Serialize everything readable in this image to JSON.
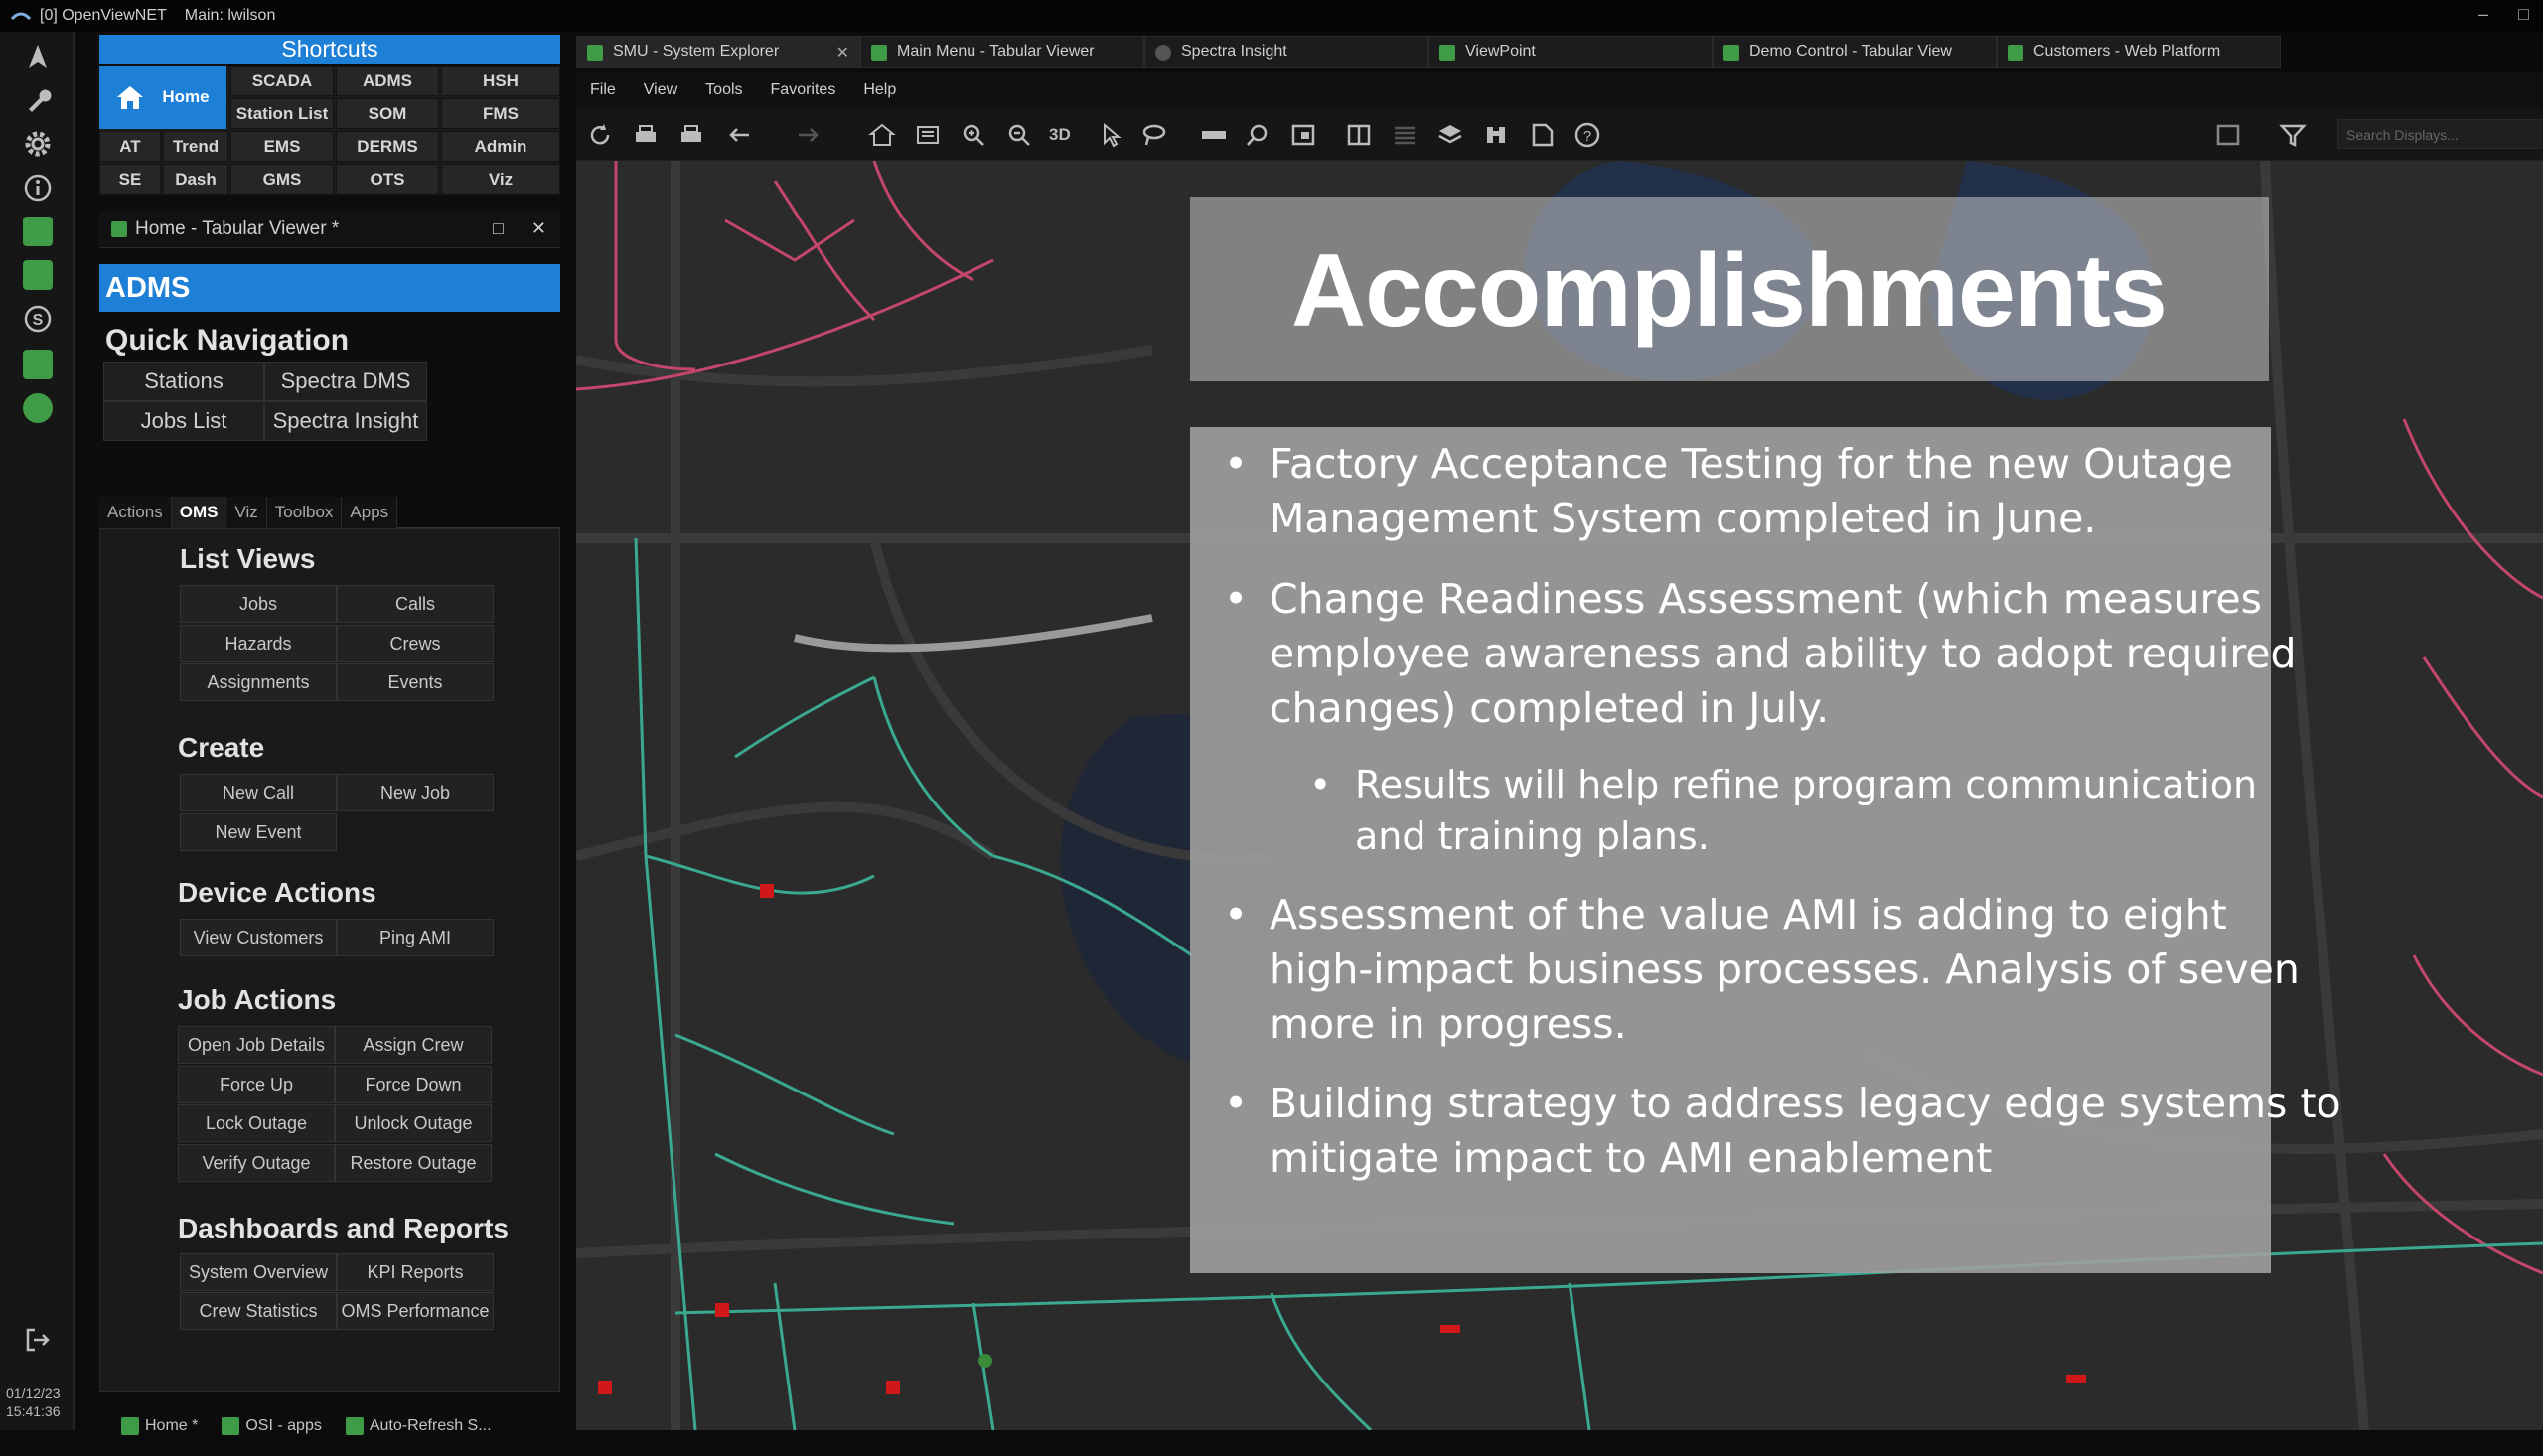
{
  "titlebar": {
    "app": "[0] OpenViewNET",
    "main": "Main: lwilson",
    "min": "–",
    "max": "□"
  },
  "rail": {
    "date": "01/12/23",
    "time": "15:41:36"
  },
  "shortcuts": {
    "header": "Shortcuts",
    "home": "Home",
    "buttons": [
      "SCADA",
      "ADMS",
      "HSH",
      "Station List",
      "SOM",
      "FMS",
      "AT",
      "Trend",
      "EMS",
      "DERMS",
      "Admin",
      "SE",
      "Dash",
      "GMS",
      "OTS",
      "Viz"
    ]
  },
  "tabular_viewer": {
    "title": "Home - Tabular Viewer *",
    "restore": "□",
    "close": "✕"
  },
  "adms": {
    "banner": "ADMS",
    "quick_nav_title": "Quick Navigation",
    "quick_nav": [
      "Stations",
      "Spectra DMS",
      "Jobs List",
      "Spectra Insight"
    ],
    "tabs": [
      "Actions",
      "OMS",
      "Viz",
      "Toolbox",
      "Apps"
    ],
    "list_views_title": "List Views",
    "list_views": [
      "Jobs",
      "Calls",
      "Hazards",
      "Crews",
      "Assignments",
      "Events"
    ],
    "create_title": "Create",
    "create": [
      "New Call",
      "New Job",
      "New Event"
    ],
    "device_actions_title": "Device Actions",
    "device_actions": [
      "View Customers",
      "Ping AMI"
    ],
    "job_actions_title": "Job Actions",
    "job_actions": [
      "Open Job Details",
      "Assign Crew",
      "Force Up",
      "Force Down",
      "Lock Outage",
      "Unlock Outage",
      "Verify Outage",
      "Restore Outage"
    ],
    "dash_title": "Dashboards and Reports",
    "dash": [
      "System Overview",
      "KPI Reports",
      "Crew Statistics",
      "OMS Performance"
    ]
  },
  "bottom_tabs": [
    "Home *",
    "OSI - apps",
    "Auto-Refresh S..."
  ],
  "window_tabs": [
    {
      "label": "SMU - System Explorer",
      "close": "✕"
    },
    {
      "label": "Main Menu - Tabular Viewer"
    },
    {
      "label": "Spectra Insight"
    },
    {
      "label": "ViewPoint"
    },
    {
      "label": "Demo Control - Tabular View"
    },
    {
      "label": "Customers - Web Platform"
    }
  ],
  "menu": [
    "File",
    "View",
    "Tools",
    "Favorites",
    "Help"
  ],
  "toolbar": {
    "search_placeholder": "Search Displays...",
    "label_3d": "3D"
  },
  "slide": {
    "title": "Accomplishments",
    "bullets": [
      {
        "level": 1,
        "lines": [
          "Factory Acceptance Testing for the new Outage",
          "Management System completed in June."
        ]
      },
      {
        "level": 1,
        "lines": [
          "Change Readiness Assessment (which measures",
          "employee awareness and ability to adopt required",
          "changes) completed in July."
        ]
      },
      {
        "level": 2,
        "lines": [
          "Results will help refine program communication",
          "and training plans."
        ]
      },
      {
        "level": 1,
        "lines": [
          "Assessment of the value AMI is adding to eight",
          "high-impact business processes.  Analysis of seven",
          "more in progress."
        ]
      },
      {
        "level": 1,
        "lines": [
          "Building strategy to address legacy edge systems to",
          "mitigate impact to AMI enablement"
        ]
      }
    ]
  },
  "colors": {
    "accent": "#1e7fd6",
    "green": "#3f9b46",
    "map_bg": "#2b2b2b",
    "road_red": "#c2476a",
    "road_teal": "#3aa98f"
  }
}
